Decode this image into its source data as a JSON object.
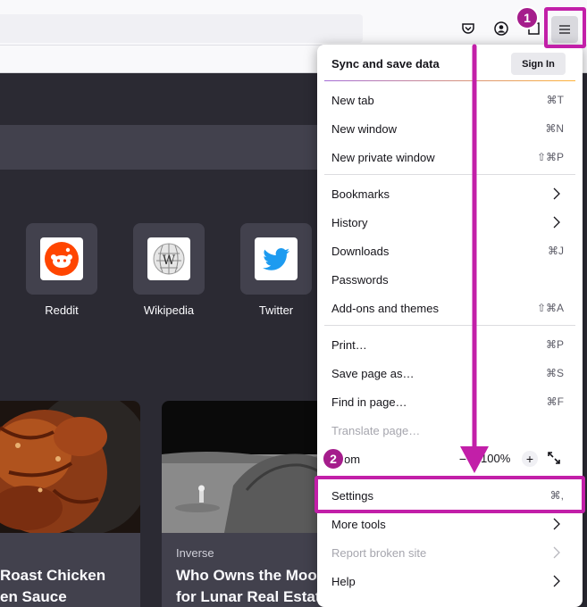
{
  "menu": {
    "header": "Sync and save data",
    "sign_in": "Sign In",
    "items": [
      {
        "label": "New tab",
        "shortcut": "⌘T"
      },
      {
        "label": "New window",
        "shortcut": "⌘N"
      },
      {
        "label": "New private window",
        "shortcut": "⇧⌘P"
      },
      {
        "label": "Bookmarks",
        "shortcut": ""
      },
      {
        "label": "History",
        "shortcut": ""
      },
      {
        "label": "Downloads",
        "shortcut": "⌘J"
      },
      {
        "label": "Passwords",
        "shortcut": ""
      },
      {
        "label": "Add-ons and themes",
        "shortcut": "⇧⌘A"
      },
      {
        "label": "Print…",
        "shortcut": "⌘P"
      },
      {
        "label": "Save page as…",
        "shortcut": "⌘S"
      },
      {
        "label": "Find in page…",
        "shortcut": "⌘F"
      },
      {
        "label": "Translate page…",
        "shortcut": ""
      },
      {
        "label": "om",
        "shortcut": ""
      },
      {
        "label": "Settings",
        "shortcut": "⌘,"
      },
      {
        "label": "More tools",
        "shortcut": ""
      },
      {
        "label": "Report broken site",
        "shortcut": ""
      },
      {
        "label": "Help",
        "shortcut": ""
      }
    ],
    "zoom": {
      "minus": "−",
      "value": "100%",
      "plus": "+"
    }
  },
  "shortcuts": [
    {
      "label": "Reddit"
    },
    {
      "label": "Wikipedia"
    },
    {
      "label": "Twitter"
    }
  ],
  "stories": [
    {
      "source": "",
      "title_line1": "Roast Chicken",
      "title_line2": "en Sauce"
    },
    {
      "source": "Inverse",
      "title_line1": "Who Owns the Moo",
      "title_line2": "for Lunar Real Estat"
    }
  ],
  "annotations": {
    "step1": "1",
    "step2": "2",
    "color": "#c21fa8"
  }
}
